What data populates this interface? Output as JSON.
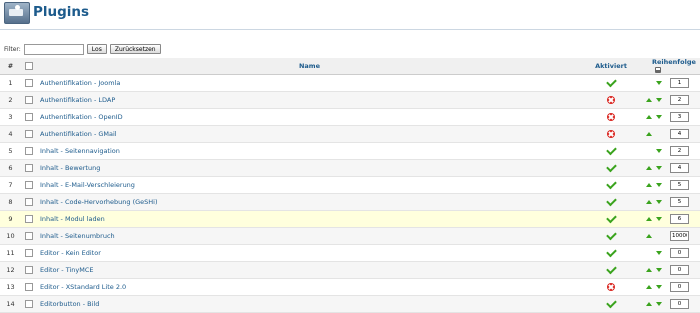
{
  "header": {
    "title": "Plugins"
  },
  "filter": {
    "label": "Filter:",
    "value": "",
    "go_label": "Los",
    "reset_label": "Zurücksetzen"
  },
  "table": {
    "col_num": "#",
    "col_name": "Name",
    "col_active": "Aktiviert",
    "col_order": "Reihenfolge",
    "rows": [
      {
        "num": "1",
        "name": "Authentifikation - Joomla",
        "active": true,
        "up": false,
        "down": true,
        "order": "1"
      },
      {
        "num": "2",
        "name": "Authentifikation - LDAP",
        "active": false,
        "up": true,
        "down": true,
        "order": "2"
      },
      {
        "num": "3",
        "name": "Authentifikation - OpenID",
        "active": false,
        "up": true,
        "down": true,
        "order": "3"
      },
      {
        "num": "4",
        "name": "Authentifikation - GMail",
        "active": false,
        "up": true,
        "down": false,
        "order": "4"
      },
      {
        "num": "5",
        "name": "Inhalt - Seitennavigation",
        "active": true,
        "up": false,
        "down": true,
        "order": "2"
      },
      {
        "num": "6",
        "name": "Inhalt - Bewertung",
        "active": true,
        "up": true,
        "down": true,
        "order": "4"
      },
      {
        "num": "7",
        "name": "Inhalt - E-Mail-Verschleierung",
        "active": true,
        "up": true,
        "down": true,
        "order": "5"
      },
      {
        "num": "8",
        "name": "Inhalt - Code-Hervorhebung (GeSHi)",
        "active": true,
        "up": true,
        "down": true,
        "order": "5"
      },
      {
        "num": "9",
        "name": "Inhalt - Modul laden",
        "active": true,
        "up": true,
        "down": true,
        "order": "6"
      },
      {
        "num": "10",
        "name": "Inhalt - Seitenumbruch",
        "active": true,
        "up": true,
        "down": false,
        "order": "10000"
      },
      {
        "num": "11",
        "name": "Editor - Kein Editor",
        "active": true,
        "up": false,
        "down": true,
        "order": "0"
      },
      {
        "num": "12",
        "name": "Editor - TinyMCE",
        "active": true,
        "up": true,
        "down": true,
        "order": "0"
      },
      {
        "num": "13",
        "name": "Editor - XStandard Lite 2.0",
        "active": false,
        "up": true,
        "down": true,
        "order": "0"
      },
      {
        "num": "14",
        "name": "Editorbutton - Bild",
        "active": true,
        "up": true,
        "down": true,
        "order": "0"
      }
    ]
  },
  "colors": {
    "accent": "#1d5b8c",
    "check": "#3aa31d",
    "disabled": "#d9221c",
    "highlight_row": "#ffffdd"
  }
}
